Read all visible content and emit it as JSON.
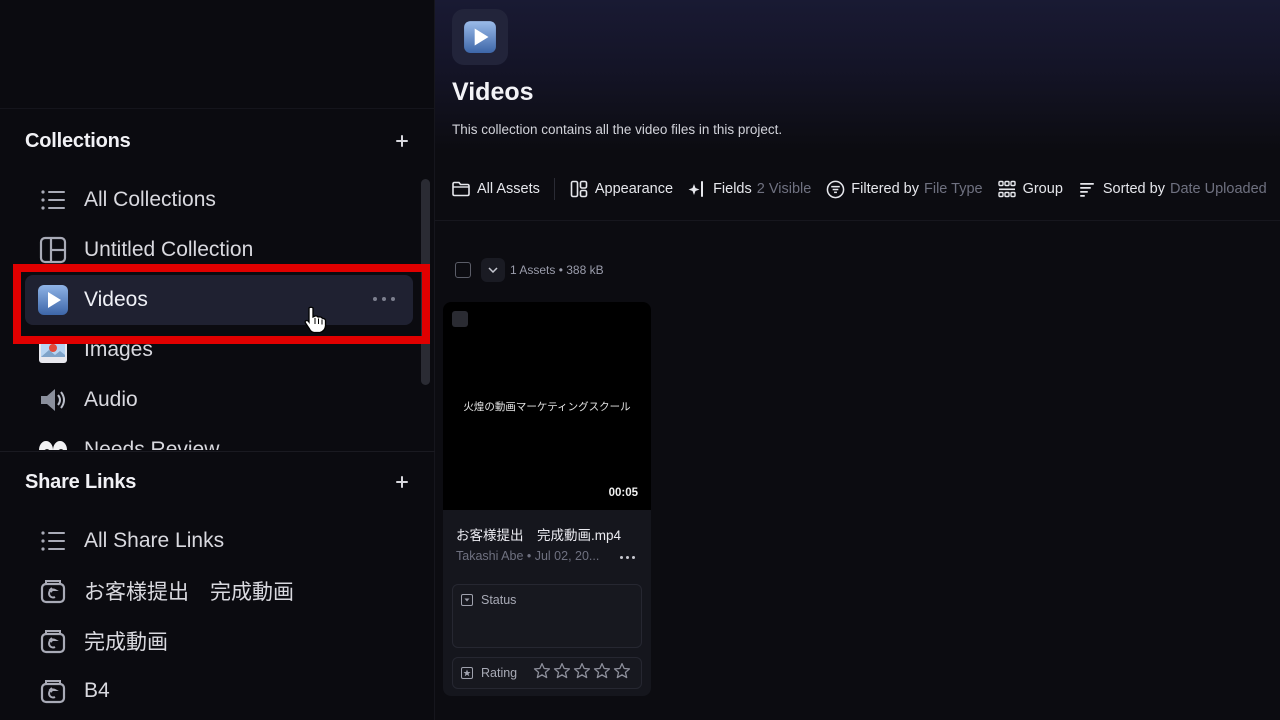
{
  "sidebar": {
    "collections": {
      "title": "Collections",
      "items": [
        {
          "label": "All Collections",
          "icon": "list-icon"
        },
        {
          "label": "Untitled Collection",
          "icon": "layout-icon"
        },
        {
          "label": "Videos",
          "icon": "video-play-icon",
          "active": true
        },
        {
          "label": "Images",
          "icon": "image-icon"
        },
        {
          "label": "Audio",
          "icon": "speaker-icon"
        },
        {
          "label": "Needs Review",
          "icon": "eyes-icon"
        }
      ]
    },
    "share_links": {
      "title": "Share Links",
      "items": [
        {
          "label": "All Share Links",
          "icon": "list-icon"
        },
        {
          "label": "お客様提出　完成動画",
          "icon": "share-link-icon"
        },
        {
          "label": "完成動画",
          "icon": "share-link-icon"
        },
        {
          "label": "B4",
          "icon": "share-link-icon"
        }
      ]
    }
  },
  "main": {
    "title": "Videos",
    "description": "This collection contains all the video files in this project.",
    "toolbar": {
      "all_assets": "All Assets",
      "appearance": "Appearance",
      "fields": "Fields",
      "fields_value": "2 Visible",
      "filtered_by": "Filtered by",
      "filtered_value": "File Type",
      "group": "Group",
      "sorted_by": "Sorted by",
      "sorted_value": "Date Uploaded"
    },
    "assets_meta": "1 Assets • 388 kB",
    "card": {
      "thumb_text": "火煌の動画マーケティングスクール",
      "duration": "00:05",
      "filename": "お客様提出　完成動画.mp4",
      "meta": "Takashi Abe • Jul 02, 20...",
      "status_label": "Status",
      "rating_label": "Rating",
      "rating_value": 0,
      "rating_max": 5
    }
  },
  "colors": {
    "highlight": "#e00000",
    "active_bg": "#1f2131",
    "hero": "#191a33"
  }
}
